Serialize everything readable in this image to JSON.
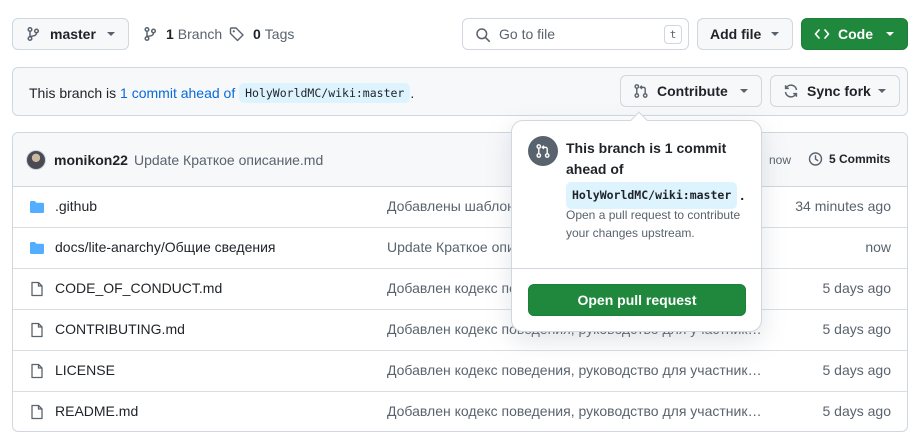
{
  "toolbar": {
    "branch_label": "master",
    "branch_count": "1",
    "branch_word": "Branch",
    "tag_count": "0",
    "tag_word": "Tags",
    "goto_placeholder": "Go to file",
    "goto_shortcut": "t",
    "add_file_label": "Add file",
    "code_label": "Code"
  },
  "banner": {
    "prefix": "This branch is",
    "link_text": "1 commit ahead of",
    "upstream": "HolyWorldMC/wiki:master",
    "suffix": ".",
    "contribute_label": "Contribute",
    "sync_label": "Sync fork"
  },
  "commit": {
    "author": "monikon22",
    "message": "Update Краткое описание.md",
    "time_fragment": "now",
    "commits_label": "5 Commits"
  },
  "files": [
    {
      "name": ".github",
      "type": "folder",
      "message": "Добавлены шаблоны...",
      "age": "34 minutes ago"
    },
    {
      "name": "docs/lite-anarchy/Общие сведения",
      "type": "folder",
      "message": "Update Краткое описание.md",
      "age": "now"
    },
    {
      "name": "CODE_OF_CONDUCT.md",
      "type": "file",
      "message": "Добавлен кодекс поведения, руководство для участнико...",
      "age": "5 days ago"
    },
    {
      "name": "CONTRIBUTING.md",
      "type": "file",
      "message": "Добавлен кодекс поведения, руководство для участнико...",
      "age": "5 days ago"
    },
    {
      "name": "LICENSE",
      "type": "file",
      "message": "Добавлен кодекс поведения, руководство для участнико...",
      "age": "5 days ago"
    },
    {
      "name": "README.md",
      "type": "file",
      "message": "Добавлен кодекс поведения, руководство для участнико...",
      "age": "5 days ago"
    }
  ],
  "popover": {
    "title_line1": "This branch is 1 commit",
    "title_line2": "ahead of",
    "upstream": "HolyWorldMC/wiki:master",
    "period": ".",
    "desc": "Open a pull request to contribute your changes upstream.",
    "button_label": "Open pull request"
  },
  "colors": {
    "accent_green": "#1f883d",
    "link_blue": "#0969da",
    "folder_blue": "#54aeff"
  }
}
